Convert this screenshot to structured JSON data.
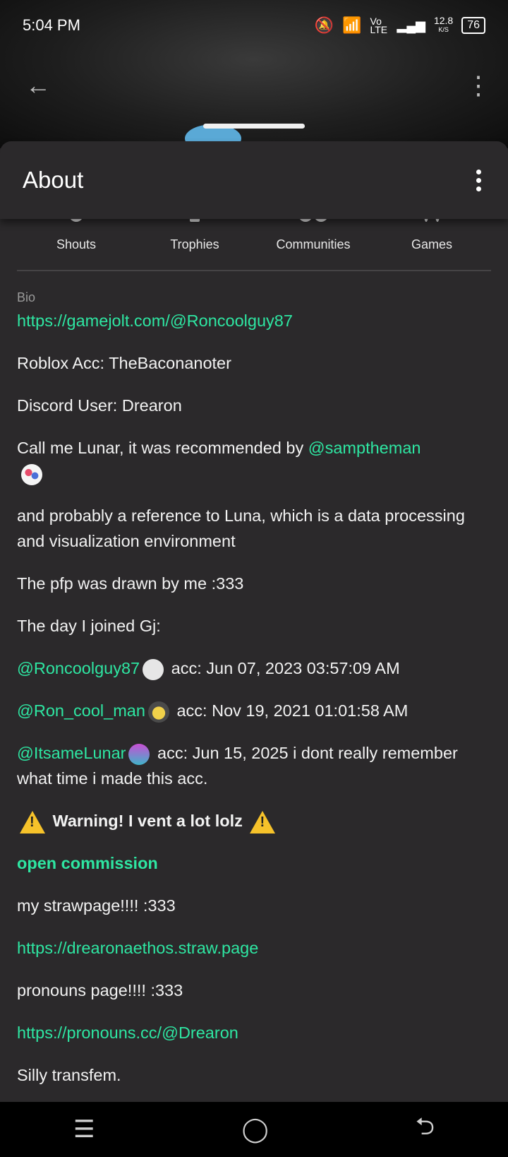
{
  "status": {
    "time": "5:04 PM",
    "network_speed": "12.8",
    "network_unit": "K/S",
    "battery": "76",
    "volte": "Vo LTE"
  },
  "header": {
    "title": "About"
  },
  "stats": [
    {
      "label": "Shouts"
    },
    {
      "label": "Trophies"
    },
    {
      "label": "Communities"
    },
    {
      "label": "Games"
    }
  ],
  "bio": {
    "label": "Bio",
    "gamejolt_link": "https://gamejolt.com/@Roncoolguy87",
    "roblox": "Roblox Acc: TheBaconanoter",
    "discord": "Discord User: Drearon",
    "lunar_text": "Call me Lunar, it was recommended by ",
    "lunar_mention": "@samptheman",
    "luna_text": "and probably a reference to Luna, which is a data processing and visualization environment",
    "pfp_text": "The pfp was drawn by me :333",
    "joined_text": "The day I joined Gj:",
    "acc1_mention": "@Roncoolguy87",
    "acc1_text": " acc: Jun 07, 2023 03:57:09 AM",
    "acc2_mention": "@Ron_cool_man",
    "acc2_text": " acc: Nov 19, 2021 01:01:58 AM",
    "acc3_mention": "@ItsameLunar",
    "acc3_text": " acc: Jun 15, 2025 i dont really remember what time i made this acc.",
    "warning_text": " Warning! I vent a lot lolz ",
    "commission": "open commission",
    "strawpage_text": "my strawpage!!!! :333",
    "strawpage_link": "https://drearonaethos.straw.page",
    "pronouns_text": "pronouns page!!!! :333",
    "pronouns_link": "https://pronouns.cc/@Drearon",
    "identity": "Silly transfem."
  },
  "colors": {
    "background": "#2b292b",
    "link": "#2ee6a2",
    "warning": "#f6c22a"
  }
}
